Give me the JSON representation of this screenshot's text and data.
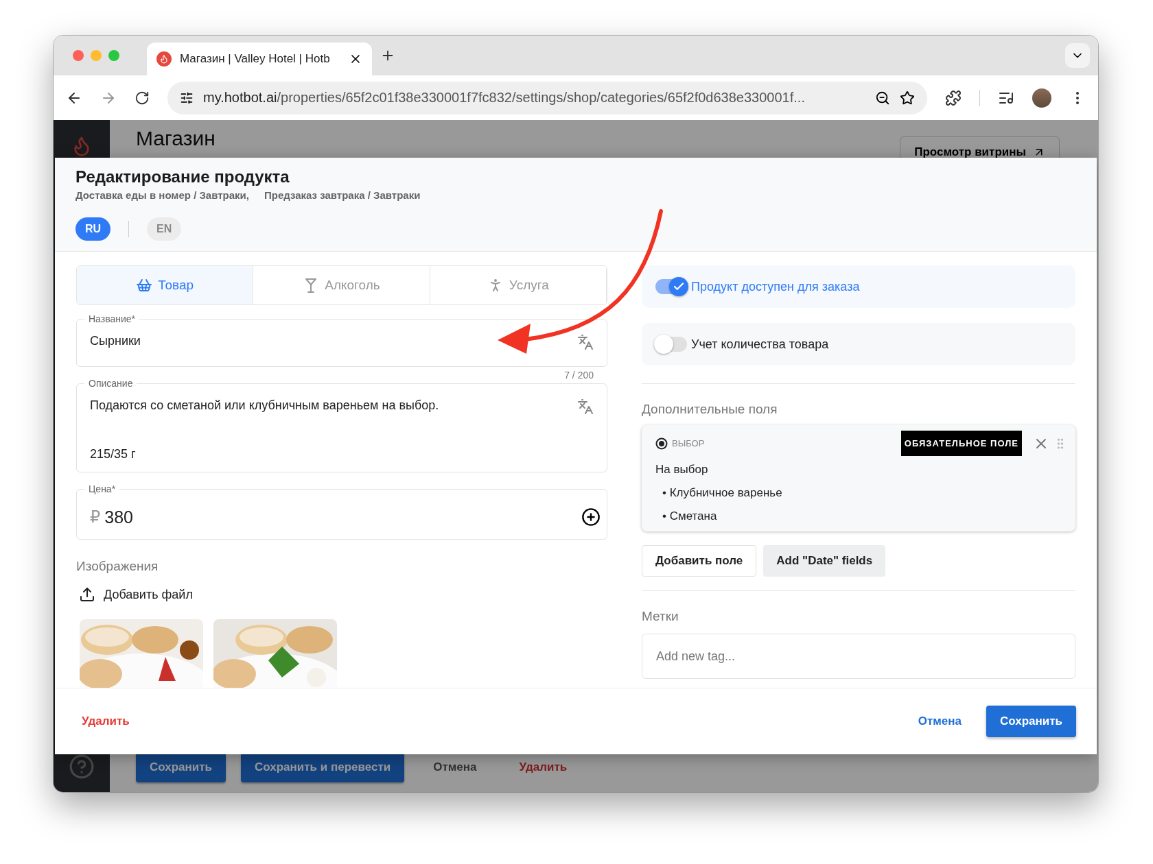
{
  "browser": {
    "tab_title": "Магазин | Valley Hotel | Hotb",
    "url_host": "my.hotbot.ai",
    "url_path": "/properties/65f2c01f38e330001f7fc832/settings/shop/categories/65f2f0d638e330001f..."
  },
  "app": {
    "title": "Магазин",
    "storefront_button": "Просмотр витрины",
    "bottom_buttons": [
      {
        "label": "Сохранить",
        "kind": "primary"
      },
      {
        "label": "Сохранить и перевести",
        "kind": "primary"
      },
      {
        "label": "Отмена",
        "kind": "text"
      },
      {
        "label": "Удалить",
        "kind": "danger"
      }
    ]
  },
  "modal": {
    "title": "Редактирование продукта",
    "breadcrumbs": [
      "Доставка еды в номер / Завтраки,",
      "Предзаказ завтрака / Завтраки"
    ],
    "languages": [
      {
        "label": "RU",
        "selected": true
      },
      {
        "label": "EN",
        "selected": false
      }
    ],
    "type_tabs": [
      {
        "label": "Товар",
        "selected": true,
        "kind": "basket"
      },
      {
        "label": "Алкоголь",
        "selected": false,
        "kind": "glass"
      },
      {
        "label": "Услуга",
        "selected": false,
        "kind": "person"
      }
    ],
    "name_field": {
      "label": "Название*",
      "value": "Сырники"
    },
    "counter": "7 / 200",
    "description_field": {
      "label": "Описание",
      "lines": [
        "Подаются со сметаной или клубничным вареньем на выбор.",
        "215/35 г"
      ]
    },
    "price_field": {
      "label": "Цена*",
      "currency": "₽",
      "value": "380"
    },
    "images_label": "Изображения",
    "add_file": "Добавить файл",
    "images": [
      {
        "kind": "picture"
      },
      {
        "kind": "picture"
      }
    ],
    "toggles": [
      {
        "label": "Продукт доступен для заказа",
        "on": true
      },
      {
        "label": "Учет количества товара",
        "on": false
      }
    ],
    "extra_fields_label": "Дополнительные поля",
    "extra_field": {
      "type_label": "ВЫБОР",
      "required_badge": "ОБЯЗАТЕЛЬНОЕ ПОЛЕ",
      "title": "На выбор",
      "options": [
        "• Клубничное варенье",
        "• Сметана"
      ]
    },
    "field_buttons": [
      {
        "label": "Добавить поле",
        "kind": "outline"
      },
      {
        "label": "Add \"Date\" fields",
        "kind": "filled"
      }
    ],
    "tags_label": "Метки",
    "tag_placeholder": "Add new tag...",
    "footer": {
      "delete": "Удалить",
      "cancel": "Отмена",
      "save": "Сохранить"
    }
  }
}
